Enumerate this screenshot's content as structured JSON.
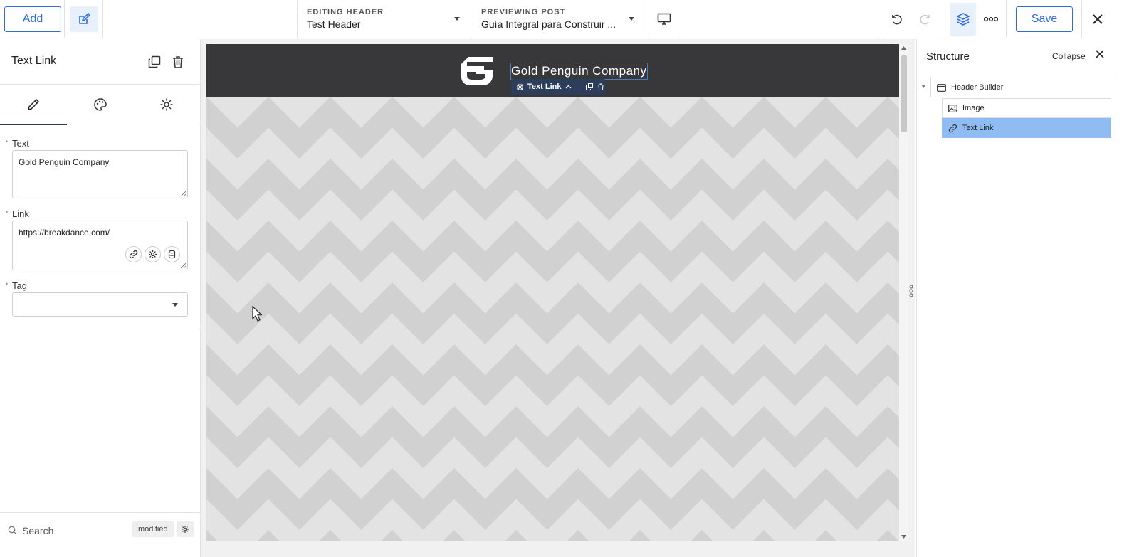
{
  "toolbar": {
    "add_label": "Add",
    "editing_label": "EDITING HEADER",
    "editing_value": "Test Header",
    "previewing_label": "PREVIEWING POST",
    "previewing_value": "Guía Integral para Construir ...",
    "save_label": "Save"
  },
  "left_panel": {
    "title": "Text Link",
    "fields": {
      "text_label": "Text",
      "text_value": "Gold Penguin Company",
      "link_label": "Link",
      "link_value": "https://breakdance.com/",
      "tag_label": "Tag",
      "tag_value": ""
    },
    "search_placeholder": "Search",
    "modified_chip": "modified"
  },
  "preview": {
    "site_title": "Gold Penguin Company",
    "selected_element_label": "Text Link",
    "header_bg": "#38383a"
  },
  "structure_panel": {
    "title": "Structure",
    "collapse_label": "Collapse",
    "tree": [
      {
        "label": "Header Builder",
        "icon": "header-icon"
      },
      {
        "label": "Image",
        "icon": "image-icon"
      },
      {
        "label": "Text Link",
        "icon": "link-icon",
        "selected": true
      }
    ]
  },
  "colors": {
    "accent": "#2e6fd6",
    "selected_tree": "#8fbcf2",
    "toolbar_selected": "#2c3e5c"
  }
}
